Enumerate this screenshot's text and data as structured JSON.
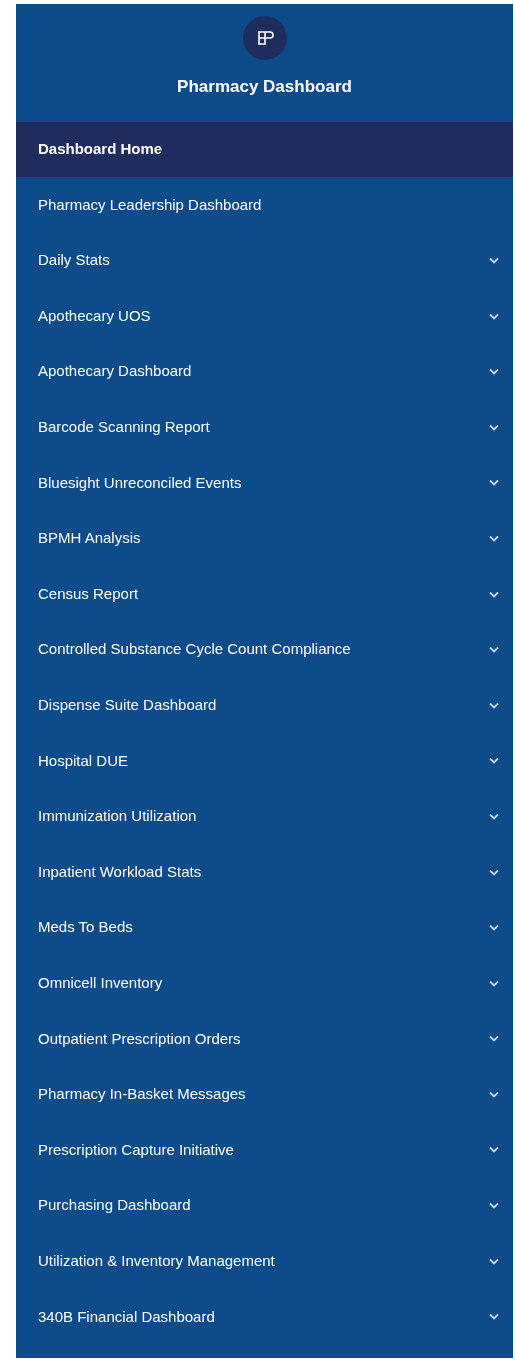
{
  "sidebar": {
    "title": "Pharmacy Dashboard",
    "items": [
      {
        "label": "Dashboard Home",
        "selected": true,
        "expandable": false
      },
      {
        "label": "Pharmacy Leadership Dashboard",
        "selected": false,
        "expandable": false
      },
      {
        "label": "Daily Stats",
        "selected": false,
        "expandable": true
      },
      {
        "label": "Apothecary UOS",
        "selected": false,
        "expandable": true
      },
      {
        "label": "Apothecary Dashboard",
        "selected": false,
        "expandable": true
      },
      {
        "label": "Barcode Scanning Report",
        "selected": false,
        "expandable": true
      },
      {
        "label": "Bluesight Unreconciled Events",
        "selected": false,
        "expandable": true
      },
      {
        "label": "BPMH Analysis",
        "selected": false,
        "expandable": true
      },
      {
        "label": "Census Report",
        "selected": false,
        "expandable": true
      },
      {
        "label": "Controlled Substance Cycle Count Compliance",
        "selected": false,
        "expandable": true
      },
      {
        "label": "Dispense Suite Dashboard",
        "selected": false,
        "expandable": true
      },
      {
        "label": "Hospital DUE",
        "selected": false,
        "expandable": true
      },
      {
        "label": "Immunization Utilization",
        "selected": false,
        "expandable": true
      },
      {
        "label": "Inpatient Workload Stats",
        "selected": false,
        "expandable": true
      },
      {
        "label": "Meds To Beds",
        "selected": false,
        "expandable": true
      },
      {
        "label": "Omnicell Inventory",
        "selected": false,
        "expandable": true
      },
      {
        "label": "Outpatient Prescription Orders",
        "selected": false,
        "expandable": true
      },
      {
        "label": "Pharmacy In-Basket Messages",
        "selected": false,
        "expandable": true
      },
      {
        "label": "Prescription Capture Initiative",
        "selected": false,
        "expandable": true
      },
      {
        "label": "Purchasing Dashboard",
        "selected": false,
        "expandable": true
      },
      {
        "label": "Utilization & Inventory Management",
        "selected": false,
        "expandable": true
      },
      {
        "label": "340B Financial Dashboard",
        "selected": false,
        "expandable": true
      }
    ]
  }
}
